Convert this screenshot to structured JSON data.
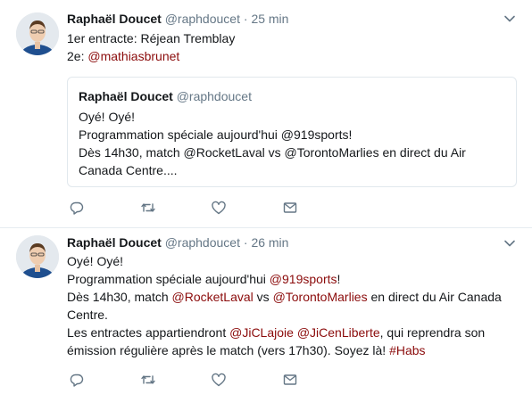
{
  "tweet1": {
    "name": "Raphaël Doucet",
    "handle": "@raphdoucet",
    "dot": "·",
    "time": "25 min",
    "line1": "1er entracte: Réjean Tremblay",
    "line2_prefix": "2e: ",
    "line2_mention": "@mathiasbrunet",
    "quote": {
      "name": "Raphaël Doucet",
      "handle": "@raphdoucet",
      "line1": "Oyé! Oyé!",
      "line2": "Programmation spéciale aujourd'hui @919sports!",
      "line3": "Dès 14h30, match @RocketLaval vs @TorontoMarlies en direct du Air",
      "line4": "Canada Centre...."
    }
  },
  "tweet2": {
    "name": "Raphaël Doucet",
    "handle": "@raphdoucet",
    "dot": "·",
    "time": "26 min",
    "line1": "Oyé! Oyé!",
    "line2_text": "Programmation spéciale aujourd'hui ",
    "line2_mention": "@919sports",
    "line2_end": "!",
    "line3_a": "Dès 14h30, match ",
    "line3_m1": "@RocketLaval",
    "line3_b": " vs ",
    "line3_m2": "@TorontoMarlies",
    "line3_c": " en direct du Air Canada",
    "line4": "Centre.",
    "line5_a": "Les entractes appartiendront ",
    "line5_m1": "@JiCLajoie",
    "line5_sp": " ",
    "line5_m2": "@JiCenLiberte",
    "line5_b": ", qui reprendra son",
    "line6_a": "émission régulière après le match (vers 17h30). Soyez là! ",
    "line6_tag": "#Habs"
  },
  "icons": [
    "reply-icon",
    "retweet-icon",
    "like-icon",
    "message-icon",
    "chevron-down-icon"
  ],
  "colors": {
    "link": "#8b0b0b",
    "meta": "#657786",
    "icon": "#657786",
    "border": "#e6ecf0"
  }
}
